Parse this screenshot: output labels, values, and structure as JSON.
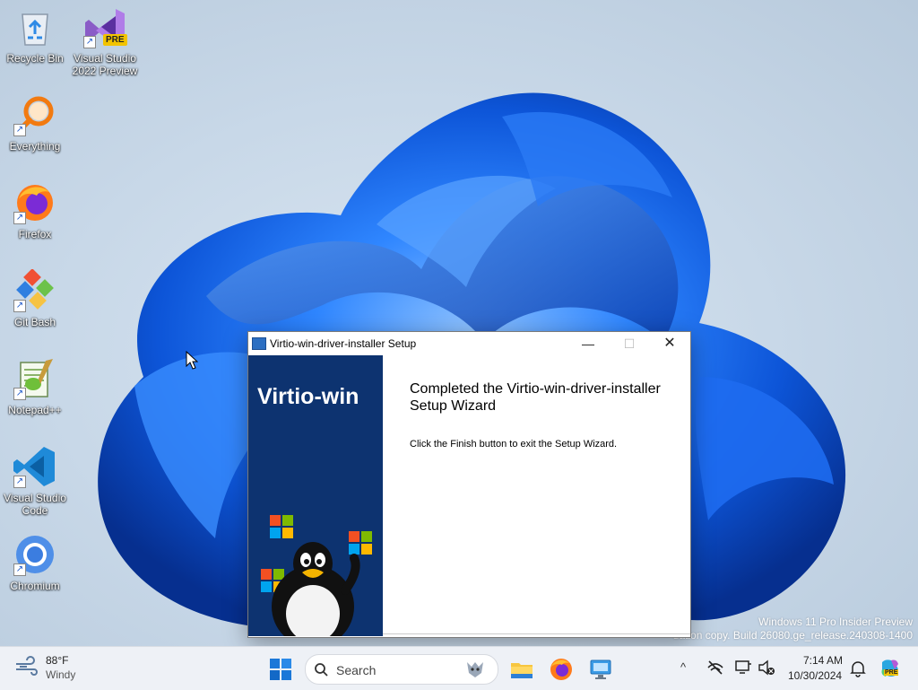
{
  "desktop": {
    "icons": [
      {
        "label": "Recycle Bin"
      },
      {
        "label": "Visual Studio 2022 Preview",
        "badge": "PRE"
      },
      {
        "label": "Everything"
      },
      {
        "label": "Firefox"
      },
      {
        "label": "Git Bash"
      },
      {
        "label": "Notepad++"
      },
      {
        "label": "Visual Studio Code"
      },
      {
        "label": "Chromium"
      }
    ],
    "watermark": {
      "line1": "Windows 11 Pro Insider Preview",
      "line2": "uation copy. Build 26080.ge_release.240308-1400"
    }
  },
  "dialog": {
    "title": "Virtio-win-driver-installer Setup",
    "minimize": "—",
    "maximize": "☐",
    "close": "✕",
    "brand": "Virtio-win",
    "heading": "Completed the Virtio-win-driver-installer Setup Wizard",
    "body": "Click the Finish button to exit the Setup Wizard."
  },
  "taskbar": {
    "weather": {
      "temp": "88°F",
      "desc": "Windy"
    },
    "search_label": "Search",
    "tray_chevron": "^",
    "clock": {
      "time": "7:14 AM",
      "date": "10/30/2024"
    },
    "copilot_badge": "PRE"
  },
  "colors": {
    "accent": "#0067c0",
    "installer_panel": "#0d3370",
    "taskbar_bg": "#eef1f6",
    "wallpaper_blue": "#1f6fea"
  }
}
